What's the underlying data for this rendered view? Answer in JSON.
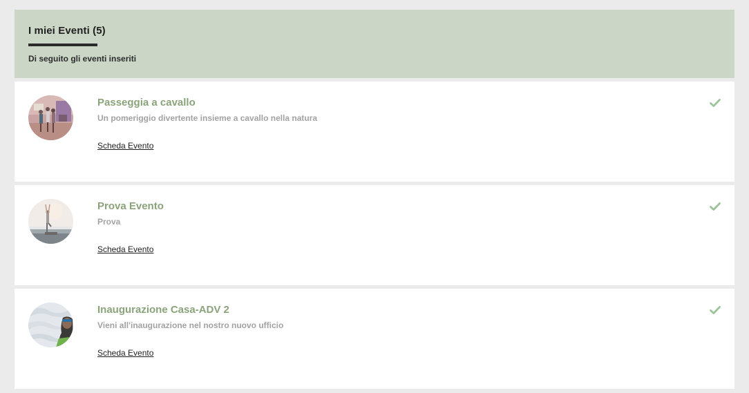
{
  "header": {
    "title": "I miei Eventi (5)",
    "subtitle": "Di seguito gli eventi inseriti"
  },
  "events": [
    {
      "title": "Passeggia a cavallo",
      "description": "Un pomeriggio divertente insieme a cavallo nella natura",
      "link": "Scheda Evento",
      "icon": "check-icon"
    },
    {
      "title": "Prova Evento",
      "description": "Prova",
      "link": "Scheda Evento",
      "icon": "check-icon"
    },
    {
      "title": "Inaugurazione Casa-ADV 2",
      "description": "Vieni all'inaugurazione nel nostro nuovo ufficio",
      "link": "Scheda Evento",
      "icon": "check-icon"
    }
  ],
  "colors": {
    "header_bg": "#ccd6c6",
    "title_green": "#8aa37b",
    "check_green": "#9cc39a"
  }
}
